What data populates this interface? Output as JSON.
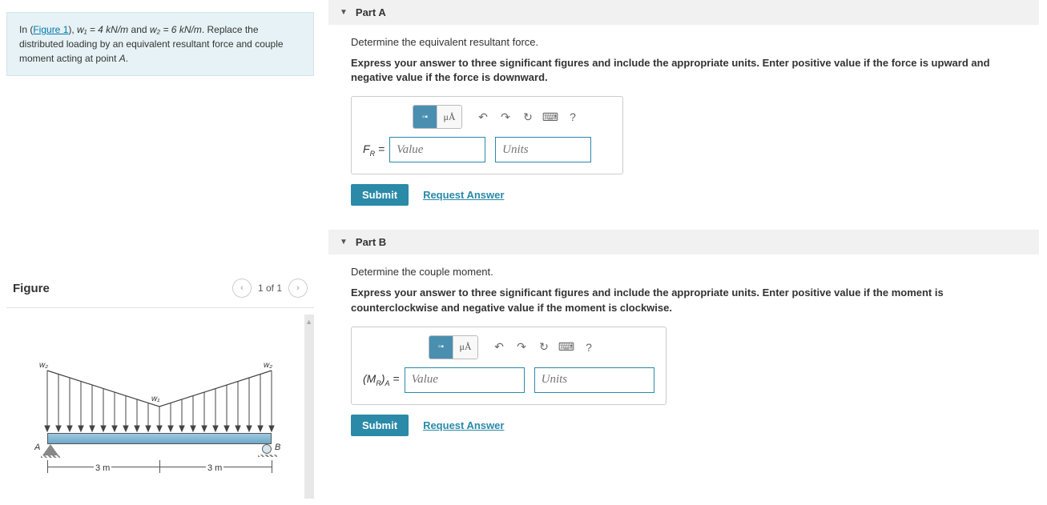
{
  "prompt": {
    "pre": "In (",
    "figure_link": "Figure 1",
    "post1": "), ",
    "var1": "w₁ = 4 kN/m",
    "mid": " and ",
    "var2": "w₂ = 6 kN/m",
    "rest": ". Replace the distributed loading by an equivalent resultant force and couple moment acting at point ",
    "pointA": "A",
    "dot": "."
  },
  "figure": {
    "title": "Figure",
    "counter": "1 of 1",
    "labelA": "A",
    "labelB": "B",
    "dim_left": "3 m",
    "dim_right": "3 m",
    "w1_label": "w₁",
    "w2_label_left": "w₂",
    "w2_label_right": "w₂"
  },
  "partA": {
    "title": "Part A",
    "question": "Determine the equivalent resultant force.",
    "instruction": "Express your answer to three significant figures and include the appropriate units. Enter positive value if the force is upward and negative value if the force is downward.",
    "var_label_html": "F_R =",
    "value_placeholder": "Value",
    "units_placeholder": "Units",
    "submit": "Submit",
    "request": "Request Answer",
    "mu_label": "μÅ"
  },
  "partB": {
    "title": "Part B",
    "question": "Determine the couple moment.",
    "instruction": "Express your answer to three significant figures and include the appropriate units. Enter positive value if the moment is counterclockwise and negative value if the moment is clockwise.",
    "var_label_html": "(M_R)_A =",
    "value_placeholder": "Value",
    "units_placeholder": "Units",
    "submit": "Submit",
    "request": "Request Answer",
    "mu_label": "μÅ"
  }
}
